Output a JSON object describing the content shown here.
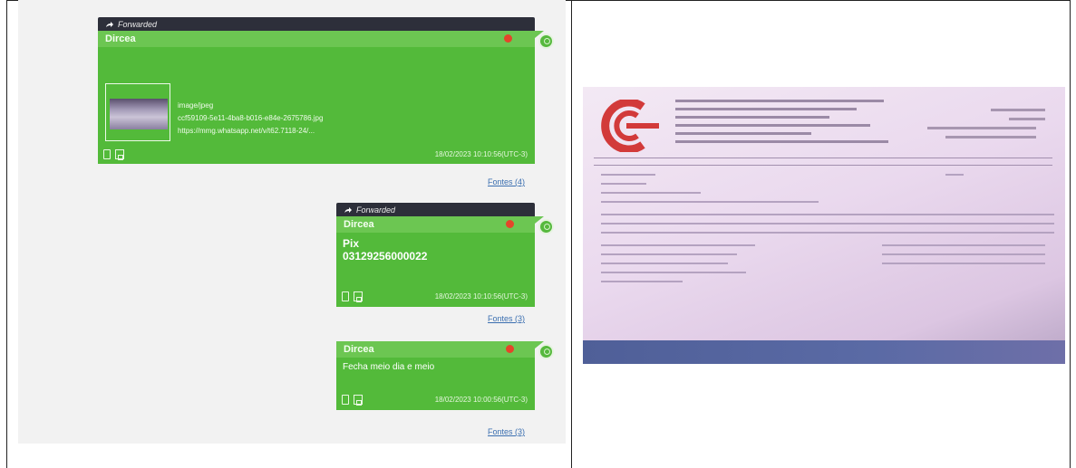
{
  "chat": {
    "messages": [
      {
        "forwarded_label": "Forwarded",
        "sender": "Dircea",
        "attachment": {
          "filename": "image/jpeg",
          "id_line": "ccf59109-5e11-4ba8-b016-e84e-2675786.jpg",
          "url_line": "https://mmg.whatsapp.net/v/t62.7118-24/...",
          "thumbnail_alt": "image thumbnail"
        },
        "timestamp": "18/02/2023 10:10:56(UTC-3)",
        "fontes": "Fontes (4)"
      },
      {
        "forwarded_label": "Forwarded",
        "sender": "Dircea",
        "line1": "Pix",
        "line2": "03129256000022",
        "timestamp": "18/02/2023 10:10:56(UTC-3)",
        "fontes": "Fontes (3)"
      },
      {
        "sender": "Dircea",
        "text": "Fecha meio dia e meio",
        "timestamp": "18/02/2023 10:00:56(UTC-3)",
        "fontes": "Fontes (3)"
      }
    ]
  },
  "colors": {
    "bubble": "#53ba3a",
    "bubble_header": "#6cc652",
    "forward_bar": "#2d2f3a",
    "status_dot": "#e4452a",
    "link": "#3b6fb0"
  },
  "icons": [
    "forward-icon",
    "status-dot-icon",
    "avatar-icon",
    "document-icon",
    "save-icon"
  ],
  "photo": {
    "alt": "Photograph of a document on a monitor screen"
  }
}
